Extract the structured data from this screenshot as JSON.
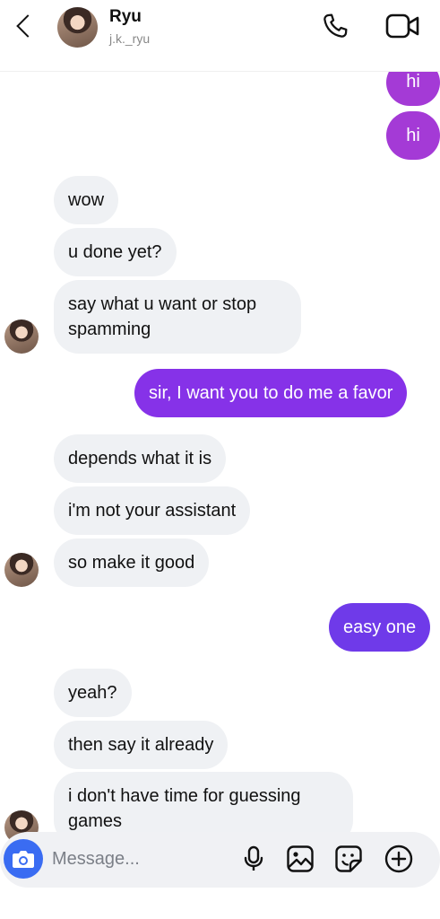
{
  "header": {
    "name": "Ryu",
    "username": "j.k._ryu"
  },
  "messages": [
    {
      "from": "me",
      "text": "hi"
    },
    {
      "from": "me",
      "text": "hi"
    },
    {
      "from": "them",
      "text": "wow"
    },
    {
      "from": "them",
      "text": "u done yet?"
    },
    {
      "from": "them",
      "text": "say what u want or stop",
      "text2": "spamming"
    },
    {
      "from": "me",
      "text": "sir, I want you to do me a favor"
    },
    {
      "from": "them",
      "text": "depends what it is"
    },
    {
      "from": "them",
      "text": "i'm not your assistant"
    },
    {
      "from": "them",
      "text": "so make it good"
    },
    {
      "from": "me",
      "text": "easy one"
    },
    {
      "from": "them",
      "text": "yeah?"
    },
    {
      "from": "them",
      "text": "then say it already"
    },
    {
      "from": "them",
      "text": "i don't have time for guessing",
      "text2": "games"
    }
  ],
  "composer": {
    "placeholder": "Message...",
    "icons": [
      "camera-icon",
      "microphone-icon",
      "gallery-icon",
      "sticker-icon",
      "add-icon"
    ]
  },
  "colors": {
    "accent_blue": "#3a6cf2",
    "sent_pink": "#a43ad6",
    "sent_violet": "#8632e8",
    "sent_indigo": "#6f3ae9",
    "received_bg": "#eff1f4"
  }
}
